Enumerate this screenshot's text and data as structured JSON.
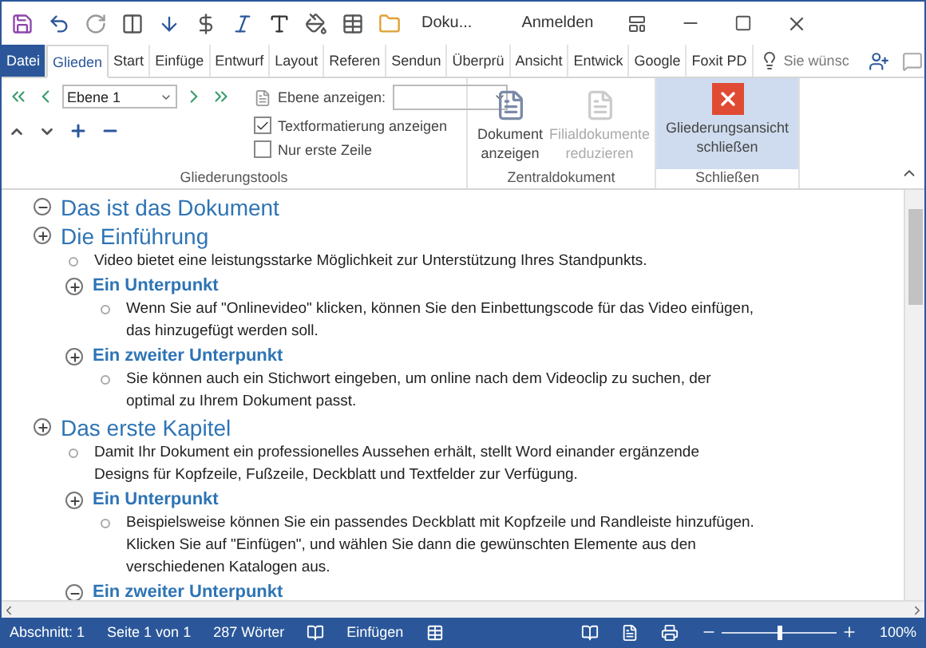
{
  "title_bar": {
    "title": "Doku...",
    "sign_in": "Anmelden"
  },
  "tabs": [
    {
      "label": "Datei",
      "kind": "file",
      "selected": false
    },
    {
      "label": "Glieden",
      "kind": "tab",
      "selected": true
    },
    {
      "label": "Start",
      "kind": "tab",
      "selected": false
    },
    {
      "label": "Einfüge",
      "kind": "tab",
      "selected": false
    },
    {
      "label": "Entwurf",
      "kind": "tab",
      "selected": false
    },
    {
      "label": "Layout",
      "kind": "tab",
      "selected": false
    },
    {
      "label": "Referen",
      "kind": "tab",
      "selected": false
    },
    {
      "label": "Sendun",
      "kind": "tab",
      "selected": false
    },
    {
      "label": "Überprü",
      "kind": "tab",
      "selected": false
    },
    {
      "label": "Ansicht",
      "kind": "tab",
      "selected": false
    },
    {
      "label": "Entwick",
      "kind": "tab",
      "selected": false
    },
    {
      "label": "Google",
      "kind": "tab",
      "selected": false
    },
    {
      "label": "Foxit PD",
      "kind": "tab",
      "selected": false
    }
  ],
  "tell_me": {
    "placeholder": "Sie wünsc"
  },
  "ribbon": {
    "level_select": {
      "value": "Ebene 1"
    },
    "show_level": {
      "label": "Ebene anzeigen:"
    },
    "checkboxes": [
      {
        "label": "Textformatierung anzeigen",
        "checked": true
      },
      {
        "label": "Nur erste Zeile",
        "checked": false
      }
    ],
    "groups": [
      {
        "label": "Gliederungstools"
      },
      {
        "label": "Zentraldokument"
      },
      {
        "label": "Schließen"
      }
    ],
    "master_buttons": [
      {
        "label": "Dokument anzeigen",
        "disabled": false
      },
      {
        "label": "Filialdokumente reduzieren",
        "disabled": true
      }
    ],
    "close_button": {
      "label": "Gliederungsansicht schließen",
      "selected": true
    }
  },
  "outline": [
    {
      "kind": "heading",
      "text": "Das ist das Dokument"
    },
    {
      "kind": "heading",
      "text": "Die Einführung",
      "children": [
        {
          "kind": "body",
          "text": "Video bietet eine leistungsstarke Möglichkeit zur Unterstützung Ihres Standpunkts."
        },
        {
          "kind": "heading",
          "text": "Ein Unterpunkt",
          "children": [
            {
              "kind": "body",
              "text": "Wenn Sie auf \"Onlinevideo\" klicken, können Sie den Einbettungscode für das Video einfügen, das hinzugefügt werden soll."
            }
          ]
        },
        {
          "kind": "heading",
          "text": "Ein zweiter Unterpunkt",
          "children": [
            {
              "kind": "body",
              "text": "Sie können auch ein Stichwort eingeben, um online nach dem Videoclip zu suchen, der optimal zu Ihrem Dokument passt."
            }
          ]
        }
      ]
    },
    {
      "kind": "heading",
      "text": "Das erste Kapitel",
      "children": [
        {
          "kind": "body",
          "text": "Damit Ihr Dokument ein professionelles Aussehen erhält, stellt Word einander ergänzende Designs für Kopfzeile, Fußzeile, Deckblatt und Textfelder zur Verfügung."
        },
        {
          "kind": "heading",
          "text": "Ein Unterpunkt",
          "children": [
            {
              "kind": "body",
              "text": "Beispielsweise können Sie ein passendes Deckblatt mit Kopfzeile und Randleiste hinzufügen. Klicken Sie auf \"Einfügen\", und wählen Sie dann die gewünschten Elemente aus den verschiedenen Katalogen aus."
            }
          ]
        },
        {
          "kind": "heading",
          "text": "Ein zweiter Unterpunkt"
        }
      ]
    }
  ],
  "status_bar": {
    "section": "Abschnitt: 1",
    "page": "Seite 1 von 1",
    "words": "287 Wörter",
    "mode": "Einfügen",
    "zoom": {
      "level": 0.5
    },
    "zoom_label": "100%"
  }
}
